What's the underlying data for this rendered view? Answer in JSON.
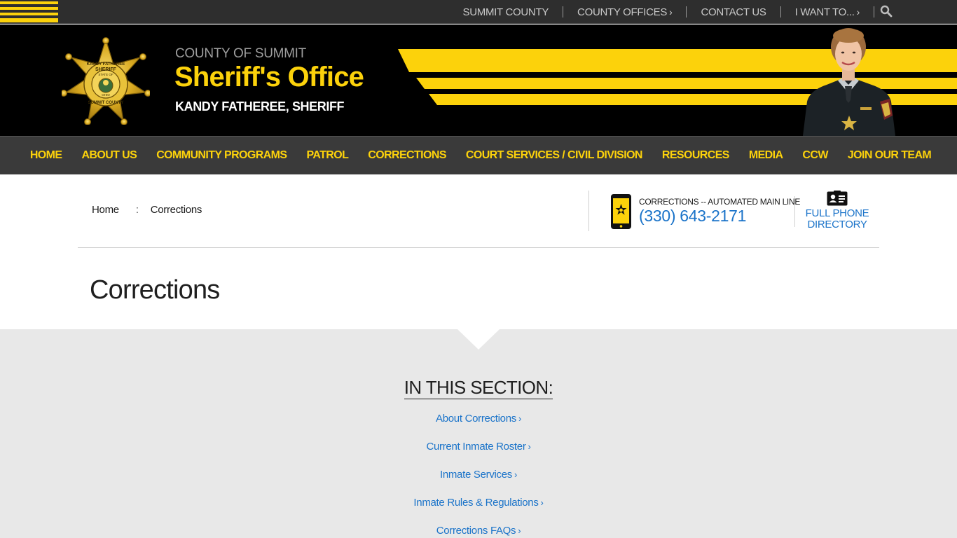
{
  "topbar": {
    "links": [
      {
        "label": "SUMMIT COUNTY",
        "chevron": ""
      },
      {
        "label": "COUNTY OFFICES",
        "chevron": "›"
      },
      {
        "label": "CONTACT US",
        "chevron": ""
      },
      {
        "label": "I WANT TO...",
        "chevron": "›"
      }
    ],
    "search_icon": "search-icon"
  },
  "header": {
    "county": "COUNTY OF SUMMIT",
    "title": "Sheriff's Office",
    "sheriff": "KANDY FATHEREE, SHERIFF",
    "badge": {
      "top_text": "KANDY FATHEREE",
      "center_text": "SHERIFF",
      "state_text": "STATE OF",
      "ohio_text": "OHIO",
      "bottom_text": "SUMMIT COUNTY"
    }
  },
  "nav": {
    "items": [
      "HOME",
      "ABOUT US",
      "COMMUNITY PROGRAMS",
      "PATROL",
      "CORRECTIONS",
      "COURT SERVICES / CIVIL DIVISION",
      "RESOURCES",
      "MEDIA",
      "CCW",
      "JOIN OUR TEAM"
    ]
  },
  "breadcrumb": {
    "home": "Home",
    "separator": ":",
    "current": "Corrections"
  },
  "contact": {
    "label": "CORRECTIONS -- AUTOMATED MAIN LINE",
    "phone": "(330) 643-2171",
    "directory_line1": "FULL PHONE",
    "directory_line2": "DIRECTORY"
  },
  "page": {
    "title": "Corrections"
  },
  "section": {
    "heading": "IN THIS SECTION:",
    "links": [
      {
        "label": "About Corrections",
        "chevron": "›"
      },
      {
        "label": "Current Inmate Roster",
        "chevron": "›"
      },
      {
        "label": "Inmate Services",
        "chevron": "›"
      },
      {
        "label": "Inmate Rules & Regulations",
        "chevron": "›"
      },
      {
        "label": "Corrections FAQs",
        "chevron": "›"
      }
    ]
  },
  "colors": {
    "accent_yellow": "#fcd20b",
    "link_blue": "#1a73c9",
    "dark_bar": "#2e2e2e",
    "nav_bg": "#3a3a3a",
    "header_bg": "#000000",
    "section_bg": "#e8e8e8"
  }
}
